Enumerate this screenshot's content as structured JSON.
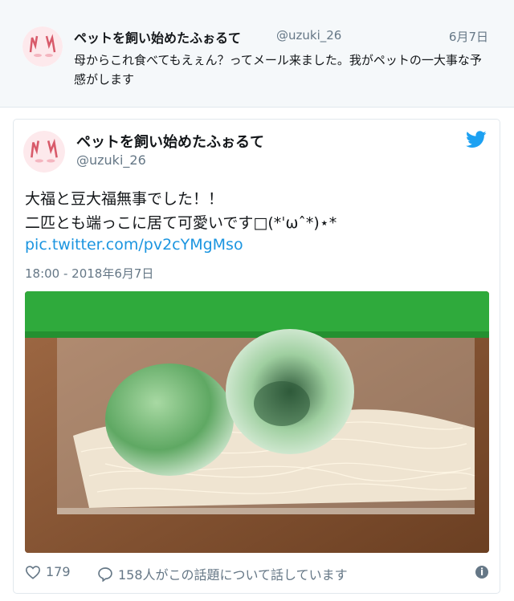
{
  "reply": {
    "name": "ペットを飼い始めたふぉるて",
    "handle": "@uzuki_26",
    "date": "6月7日",
    "text": "母からこれ食べてもえぇん？ってメール来ました。我がペットの一大事な予感がします"
  },
  "tweet": {
    "name": "ペットを飼い始めたふぉるて",
    "handle": "@uzuki_26",
    "line1": "大福と豆大福無事でした！！",
    "line2": "二匹とも端っこに居て可愛いです□(*ˈωˆ*)⋆*",
    "link": "pic.twitter.com/pv2cYMgMso",
    "timestamp": "18:00 - 2018年6月7日",
    "likes": "179",
    "replies": "158人がこの話題について話しています"
  },
  "icons": [
    "avatar-icon",
    "twitter-bird-icon",
    "heart-icon",
    "reply-icon",
    "info-icon"
  ],
  "colors": {
    "link": "#1b95e0",
    "muted": "#657786",
    "accent_green": "#2faa3c"
  }
}
